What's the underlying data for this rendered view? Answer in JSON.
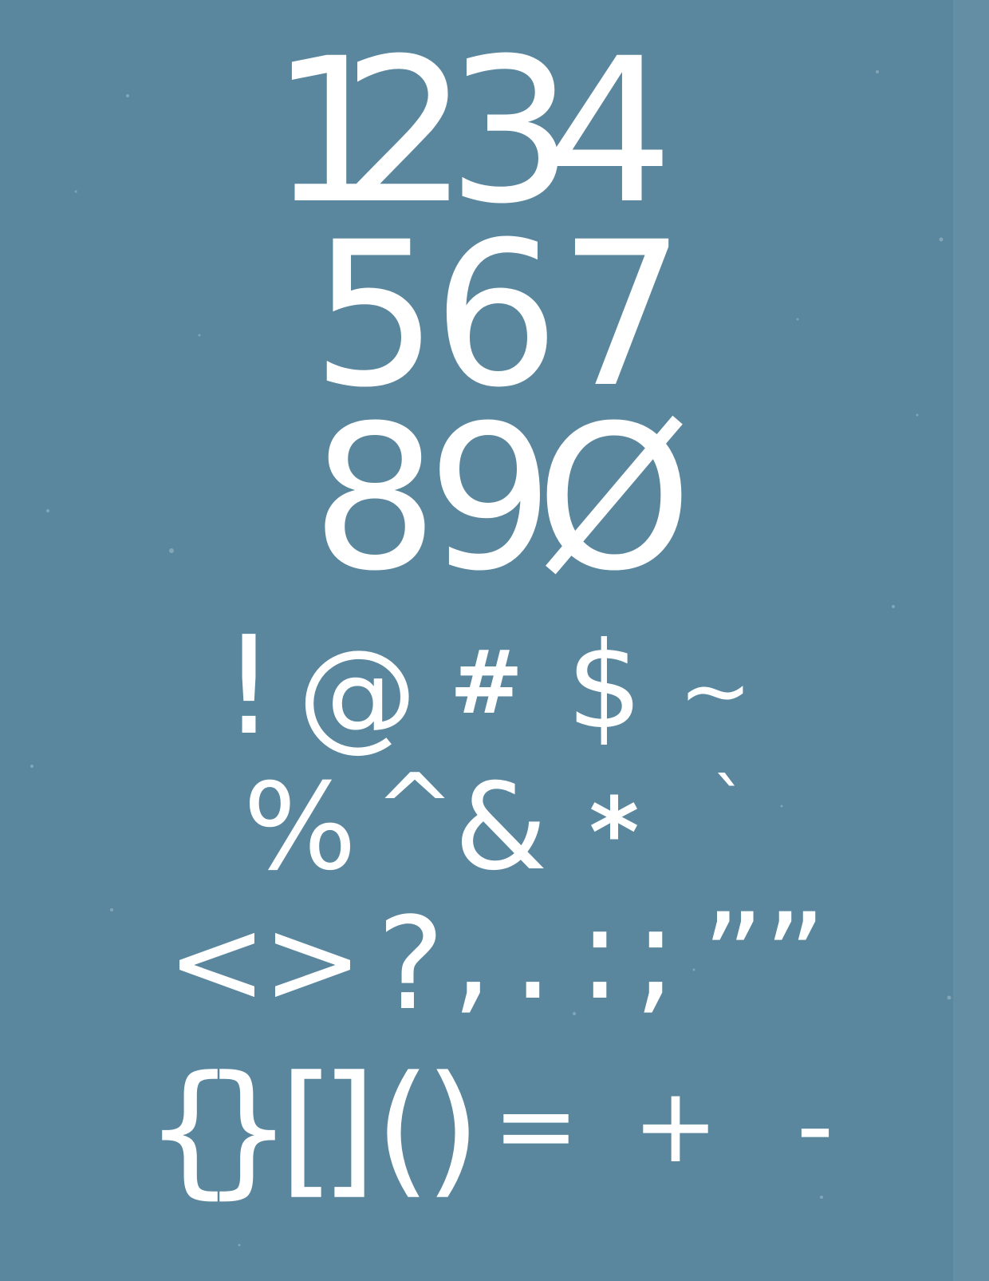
{
  "colors": {
    "background": "#5a879e",
    "glyph": "#ffffff"
  },
  "rows": [
    {
      "id": "digits-1",
      "glyphs": [
        "1",
        "2",
        "3",
        "4"
      ]
    },
    {
      "id": "digits-2",
      "glyphs": [
        "5",
        "6",
        "7"
      ]
    },
    {
      "id": "digits-3",
      "glyphs": [
        "8",
        "9",
        "Ø"
      ]
    },
    {
      "id": "symbols-1",
      "glyphs": [
        "!",
        "@",
        "#",
        "$",
        "~"
      ]
    },
    {
      "id": "symbols-2",
      "glyphs": [
        "%",
        "^",
        "&",
        "*",
        "`"
      ]
    },
    {
      "id": "symbols-3",
      "glyphs": [
        "<",
        ">",
        "?",
        ",",
        ".",
        ":",
        ";",
        "””"
      ]
    },
    {
      "id": "symbols-4",
      "glyphs": [
        "{",
        "}",
        "[",
        "]",
        "(",
        ")",
        "=",
        "+",
        "-"
      ]
    }
  ]
}
